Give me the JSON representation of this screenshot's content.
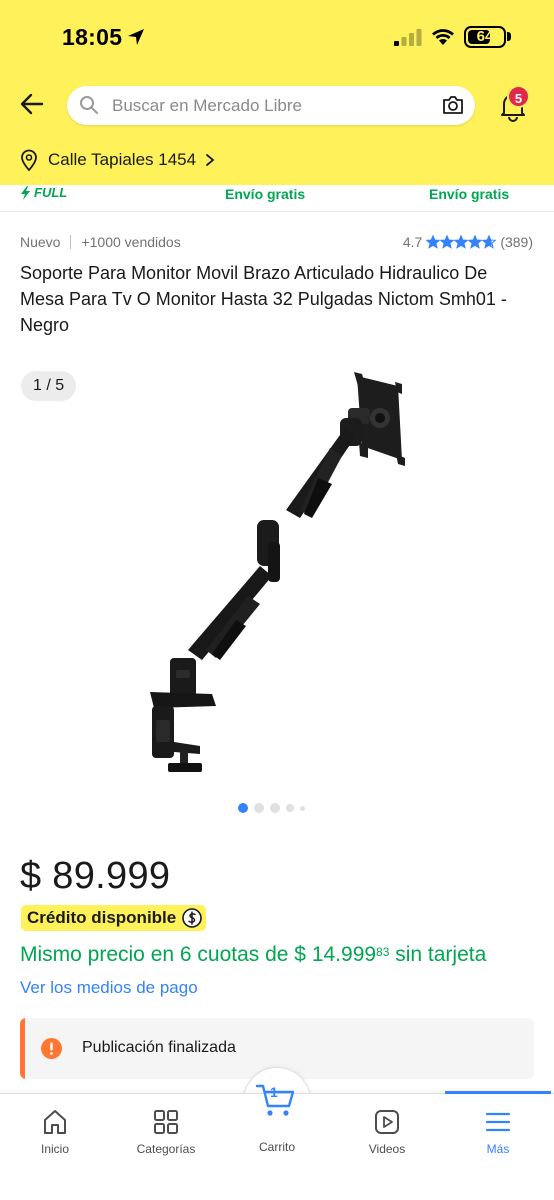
{
  "status_bar": {
    "time": "18:05",
    "battery": "64"
  },
  "header": {
    "search_placeholder": "Buscar en Mercado Libre",
    "notifications_count": "5",
    "address": "Calle Tapiales 1454"
  },
  "shipping_strip": {
    "full_label": "FULL",
    "free_shipping_1": "Envío gratis",
    "free_shipping_2": "Envío gratis"
  },
  "product": {
    "condition": "Nuevo",
    "sold": "+1000 vendidos",
    "rating": "4.7",
    "rating_stars": 4.7,
    "reviews": "(389)",
    "title": "Soporte Para Monitor Movil Brazo Articulado Hidraulico De Mesa Para Tv O Monitor Hasta 32 Pulgadas Nictom Smh01 - Negro",
    "image_counter": "1 / 5",
    "image_current": 1,
    "image_total": 5
  },
  "pricing": {
    "price": "$ 89.999",
    "credit_badge": "Crédito disponible",
    "installments_prefix": "Mismo precio en 6 cuotas de $ 14.999",
    "installments_cents": "83",
    "installments_suffix": " sin tarjeta",
    "payment_link": "Ver los medios de pago"
  },
  "notice": {
    "text": "Publicación finalizada"
  },
  "bottom_nav": {
    "items": [
      {
        "label": "Inicio",
        "icon": "home-icon"
      },
      {
        "label": "Categorías",
        "icon": "grid-icon"
      },
      {
        "label": "Carrito",
        "icon": "cart-icon",
        "count": "1"
      },
      {
        "label": "Videos",
        "icon": "play-icon"
      },
      {
        "label": "Más",
        "icon": "menu-icon",
        "active": true
      }
    ]
  },
  "colors": {
    "header_yellow": "#fff159",
    "accent_blue": "#3483fa",
    "green": "#00a650",
    "warning_orange": "#ff7733",
    "badge_red": "#e2284d"
  }
}
